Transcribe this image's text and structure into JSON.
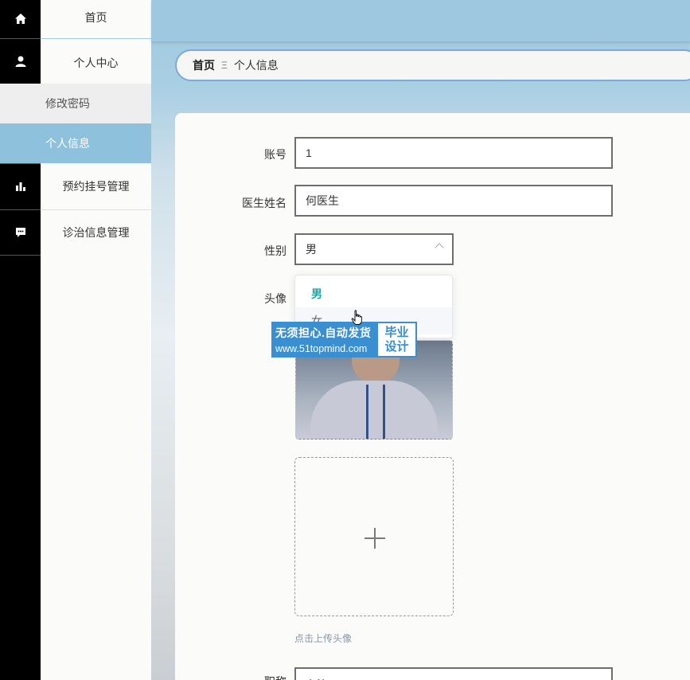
{
  "sidebar": {
    "items": [
      {
        "label": "首页",
        "icon": "home-icon"
      },
      {
        "label": "个人中心",
        "icon": "user-icon"
      },
      {
        "label": "修改密码"
      },
      {
        "label": "个人信息"
      },
      {
        "label": "预约挂号管理",
        "icon": "bar-chart-icon"
      },
      {
        "label": "诊治信息管理",
        "icon": "chat-icon"
      }
    ]
  },
  "breadcrumb": {
    "home": "首页",
    "separator": "Ξ",
    "current": "个人信息"
  },
  "form": {
    "account_label": "账号",
    "account_value": "1",
    "name_label": "医生姓名",
    "name_value": "何医生",
    "gender_label": "性别",
    "gender_value": "男",
    "gender_options": [
      "男",
      "女"
    ],
    "avatar_label": "头像",
    "upload_hint": "点击上传头像",
    "next_label": "职称",
    "next_value": "主治"
  },
  "watermark": {
    "line1": "无须担心.自动发货",
    "line2": "www.51topmind.com",
    "badge_top": "毕业",
    "badge_bottom": "设计"
  },
  "colors": {
    "accent": "#8dc1dc",
    "topbar": "#9dc8df",
    "selected_option": "#1aa79a",
    "watermark": "#3a8fd0"
  }
}
